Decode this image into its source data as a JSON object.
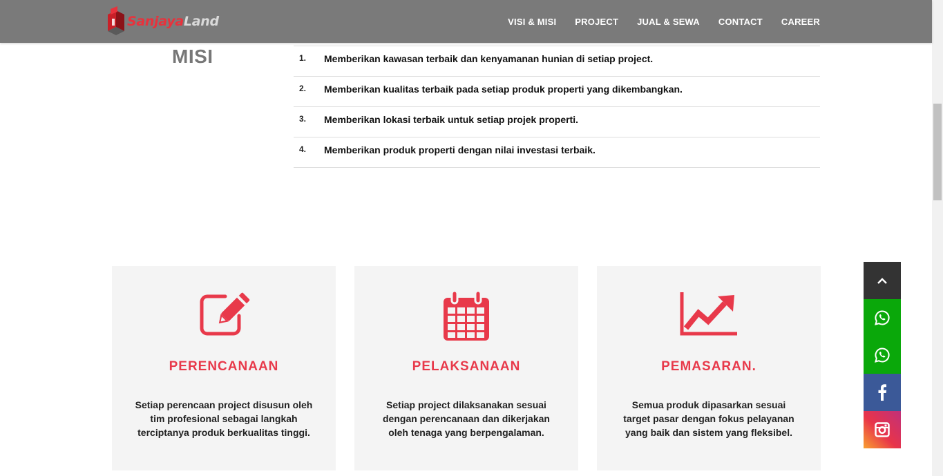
{
  "brand": {
    "name_part1": "Sanjaya",
    "name_part2": "Land",
    "accent_color": "#e8323c"
  },
  "nav": {
    "items": [
      "VISI & MISI",
      "PROJECT",
      "JUAL & SEWA",
      "CONTACT",
      "CAREER"
    ]
  },
  "misi": {
    "title": "MISI",
    "items": [
      {
        "num": "1.",
        "text": "Memberikan kawasan terbaik dan kenyamanan hunian di setiap project."
      },
      {
        "num": "2.",
        "text": "Memberikan kualitas terbaik pada setiap produk properti yang dikembangkan."
      },
      {
        "num": "3.",
        "text": "Memberikan lokasi terbaik untuk setiap projek properti."
      },
      {
        "num": "4.",
        "text": "Memberikan produk properti dengan nilai investasi terbaik."
      }
    ]
  },
  "cards": [
    {
      "icon": "edit-icon",
      "title": "PERENCANAAN",
      "desc": "Setiap perencaan project disusun oleh tim profesional sebagai langkah terciptanya produk berkualitas tinggi."
    },
    {
      "icon": "calendar-icon",
      "title": "PELAKSANAAN",
      "desc": "Setiap project dilaksanakan sesuai dengan perencanaan dan dikerjakan oleh tenaga yang berpengalaman."
    },
    {
      "icon": "line-chart-icon",
      "title": "PEMASARAN.",
      "desc": "Semua produk dipasarkan sesuai target pasar dengan fokus pelayanan yang baik dan sistem yang fleksibel."
    }
  ],
  "social": {
    "items": [
      {
        "icon": "chevron-up-icon",
        "color": "#333333"
      },
      {
        "icon": "whatsapp-icon",
        "color": "#0aa80a"
      },
      {
        "icon": "whatsapp-icon",
        "color": "#0aa80a"
      },
      {
        "icon": "facebook-icon",
        "color": "#3b5998"
      },
      {
        "icon": "instagram-icon",
        "color": "#e8344a"
      }
    ]
  }
}
